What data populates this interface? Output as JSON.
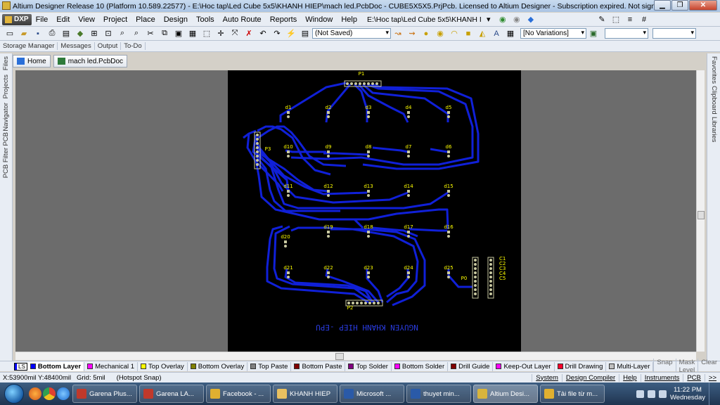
{
  "window": {
    "title": "Altium Designer Release 10 (Platform 10.589.22577) - E:\\Hoc tap\\Led Cube 5x5\\KHANH HIEP\\mach led.PcbDoc - CUBE5X5X5.PrjPcb. Licensed to Altium Designer - Subscription expired. Not signed in."
  },
  "menubar": {
    "dxp_label": "DXP",
    "items": [
      "File",
      "Edit",
      "View",
      "Project",
      "Place",
      "Design",
      "Tools",
      "Auto Route",
      "Reports",
      "Window",
      "Help"
    ],
    "path": "E:\\Hoc tap\\Led Cube 5x5\\KHANH I"
  },
  "toolbar": {
    "saved_state": "(Not Saved)",
    "variations": "[No Variations]"
  },
  "panels": [
    "Storage Manager",
    "Messages",
    "Output",
    "To-Do"
  ],
  "doc_tabs": [
    {
      "label": "Home",
      "icon": "home-icon"
    },
    {
      "label": "mach led.PcbDoc",
      "icon": "pcb-doc-icon"
    }
  ],
  "left_panels": [
    "Files",
    "Projects",
    "Navigator",
    "PCB",
    "PCB Filter"
  ],
  "right_panels": [
    "Favorites",
    "Clipboard",
    "Libraries"
  ],
  "pcb": {
    "board_text": "NGUYEN KHANH HIEP -EPU",
    "connectors": [
      "P1",
      "P3",
      "P2",
      "P0"
    ],
    "led_labels": [
      "d1",
      "d2",
      "d3",
      "d4",
      "d5",
      "d10",
      "d9",
      "d8",
      "d7",
      "d6",
      "d11",
      "d12",
      "d13",
      "d14",
      "d15",
      "d19",
      "d18",
      "d17",
      "d16",
      "d20",
      "d21",
      "d22",
      "d23",
      "d24",
      "d25"
    ],
    "column_labels": [
      "C1",
      "C2",
      "C3",
      "C4",
      "C5"
    ],
    "trace_color": "#1020d8",
    "pad_color": "#c8c8a0",
    "label_color": "#ffff00"
  },
  "layers": {
    "ls_label": "LS",
    "tabs": [
      {
        "label": "Bottom Layer",
        "color": "#0000ff"
      },
      {
        "label": "Mechanical 1",
        "color": "#ff00ff"
      },
      {
        "label": "Top Overlay",
        "color": "#ffff00"
      },
      {
        "label": "Bottom Overlay",
        "color": "#808000"
      },
      {
        "label": "Top Paste",
        "color": "#808080"
      },
      {
        "label": "Bottom Paste",
        "color": "#800000"
      },
      {
        "label": "Top Solder",
        "color": "#800080"
      },
      {
        "label": "Bottom Solder",
        "color": "#ff00ff"
      },
      {
        "label": "Drill Guide",
        "color": "#800000"
      },
      {
        "label": "Keep-Out Layer",
        "color": "#ff00ff"
      },
      {
        "label": "Drill Drawing",
        "color": "#ff002a"
      },
      {
        "label": "Multi-Layer",
        "color": "#c0c0c0"
      }
    ],
    "right": [
      "Snap",
      "Mask Level",
      "Clear"
    ]
  },
  "status": {
    "coords": "X:53900mil Y:48400mil",
    "grid": "Grid: 5mil",
    "snap": "(Hotspot Snap)",
    "right": [
      "System",
      "Design Compiler",
      "Help",
      "Instruments",
      "PCB",
      ">>"
    ]
  },
  "taskbar": {
    "tasks": [
      {
        "label": "Garena Plus...",
        "color": "#c0392b"
      },
      {
        "label": "Garena LA...",
        "color": "#c0392b"
      },
      {
        "label": "Facebook - ...",
        "color": "#e0b030"
      },
      {
        "label": "KHANH HIEP",
        "color": "#e8c060"
      },
      {
        "label": "Microsoft ...",
        "color": "#2a5aa8"
      },
      {
        "label": "thuyet min...",
        "color": "#2a5aa8"
      },
      {
        "label": "Altium Desi...",
        "color": "#d8b43c"
      },
      {
        "label": "Tải file từ m...",
        "color": "#e0b030"
      }
    ],
    "time": "11:22 PM",
    "day": "Wednesday"
  }
}
